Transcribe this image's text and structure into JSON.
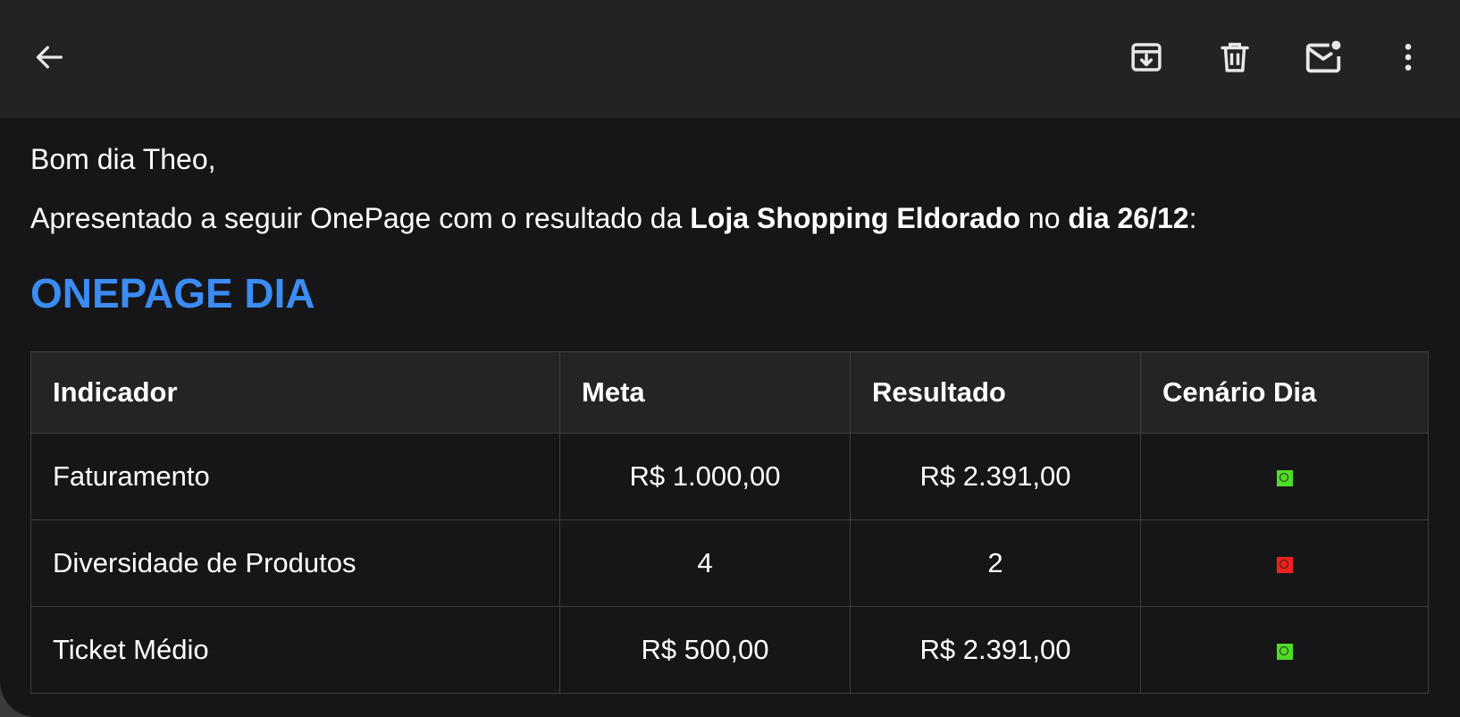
{
  "toolbar": {
    "back_icon": "arrow-left-icon",
    "archive_icon": "archive-icon",
    "delete_icon": "trash-icon",
    "mark_unread_icon": "mail-unread-icon",
    "more_icon": "more-vertical-icon"
  },
  "email": {
    "greeting": "Bom dia Theo,",
    "intro_prefix": "Apresentado a seguir OnePage com o resultado da ",
    "store_name": "Loja Shopping Eldorado",
    "intro_middle": " no ",
    "day_label": "dia 26/12",
    "intro_suffix": ":",
    "section_title": "ONEPAGE DIA"
  },
  "table": {
    "headers": {
      "indicator": "Indicador",
      "goal": "Meta",
      "result": "Resultado",
      "scenario": "Cenário Dia"
    },
    "rows": [
      {
        "indicator": "Faturamento",
        "goal": "R$ 1.000,00",
        "result": "R$ 2.391,00",
        "status": "green"
      },
      {
        "indicator": "Diversidade de Produtos",
        "goal": "4",
        "result": "2",
        "status": "red"
      },
      {
        "indicator": "Ticket Médio",
        "goal": "R$ 500,00",
        "result": "R$ 2.391,00",
        "status": "green"
      }
    ]
  },
  "colors": {
    "title_blue": "#3b8cf3",
    "status_green": "#4fdc28",
    "status_red": "#f21f1f",
    "background": "#161618",
    "toolbar": "#232325"
  }
}
